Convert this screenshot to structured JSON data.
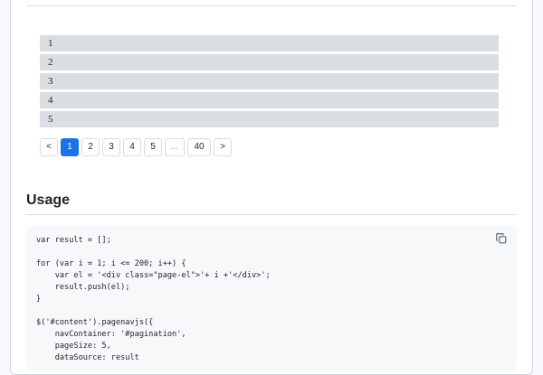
{
  "demo": {
    "items": [
      "1",
      "2",
      "3",
      "4",
      "5"
    ]
  },
  "pagination": {
    "prev": "<",
    "pages": [
      "1",
      "2",
      "3",
      "4",
      "5"
    ],
    "active": "1",
    "ellipsis": "...",
    "last": "40",
    "next": ">"
  },
  "usage": {
    "heading": "Usage",
    "code": "var result = [];\n\nfor (var i = 1; i <= 200; i++) {\n    var el = '<div class=\"page-el\">'+ i +'</div>';\n    result.push(el);\n}\n\n$('#content').pagenavjs({\n    navContainer: '#pagination',\n    pageSize: 5,\n    dataSource: result"
  },
  "colors": {
    "accent": "#1a73e8",
    "item_bg": "#dadee2"
  },
  "icons": {
    "copy": "copy-icon"
  }
}
